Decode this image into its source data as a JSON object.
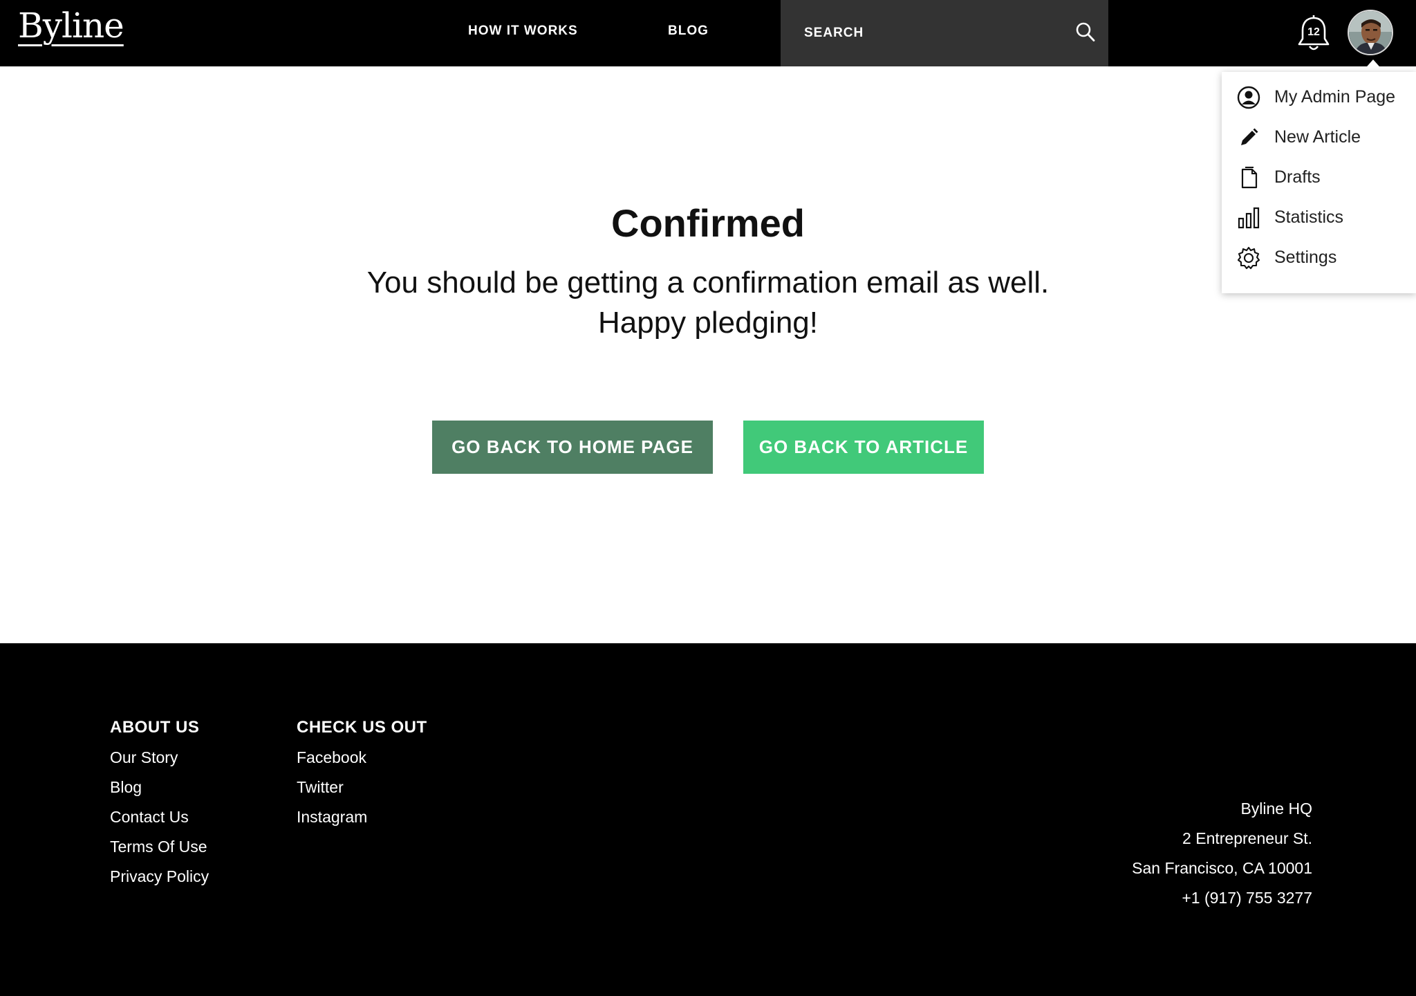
{
  "header": {
    "logo": "Byline",
    "nav": {
      "how_it_works": "HOW IT WORKS",
      "blog": "BLOG"
    },
    "search": {
      "placeholder": "SEARCH",
      "icon": "search-icon"
    },
    "notifications": {
      "count": "12",
      "icon": "bell-icon"
    },
    "avatar": "user-avatar"
  },
  "dropdown": {
    "items": [
      {
        "label": "My Admin Page",
        "icon": "user-circle-icon"
      },
      {
        "label": "New Article",
        "icon": "pencil-icon"
      },
      {
        "label": "Drafts",
        "icon": "document-icon"
      },
      {
        "label": "Statistics",
        "icon": "bar-chart-icon"
      },
      {
        "label": "Settings",
        "icon": "gear-icon"
      }
    ]
  },
  "main": {
    "title": "Confirmed",
    "message_line1": "You should be getting a confirmation email as well.",
    "message_line2": "Happy pledging!",
    "buttons": {
      "home": "GO BACK TO HOME PAGE",
      "article": "GO BACK TO ARTICLE"
    }
  },
  "footer": {
    "about": {
      "heading": "ABOUT US",
      "links": [
        "Our Story",
        "Blog",
        "Contact Us",
        "Terms Of Use",
        "Privacy Policy"
      ]
    },
    "check": {
      "heading": "CHECK US OUT",
      "links": [
        "Facebook",
        "Twitter",
        "Instagram"
      ]
    },
    "address": {
      "name": "Byline HQ",
      "street": "2 Entrepreneur St.",
      "city": "San Francisco, CA 10001",
      "phone": "+1 (917) 755 3277"
    }
  },
  "colors": {
    "header_bg": "#000000",
    "search_bg": "#333333",
    "button_home": "#4f7f63",
    "button_article": "#41c979",
    "footer_bg": "#000000"
  }
}
